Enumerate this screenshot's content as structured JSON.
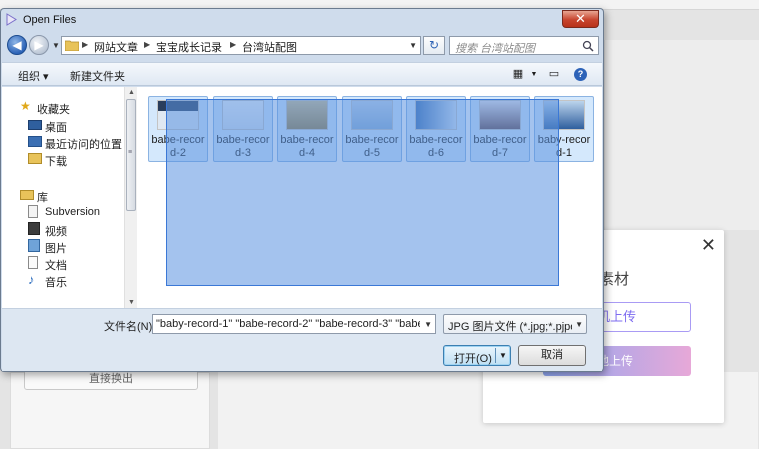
{
  "background": {
    "left_button_label": "直接换出",
    "modal": {
      "close_icon": "close-icon",
      "title_partial": "素材",
      "button_outline_label": "机上传",
      "button_gradient_label": "地上传",
      "colors": {
        "outline_accent": "#a99bf4",
        "gradient_start": "#8ea6f0",
        "gradient_end": "#e7a8d8"
      }
    }
  },
  "dialog": {
    "title": "Open Files",
    "close_label": "✕",
    "address": {
      "breadcrumbs": [
        "网站文章",
        "宝宝成长记录",
        "台湾站配图"
      ]
    },
    "search": {
      "placeholder": "搜索 台湾站配图"
    },
    "toolbar": {
      "organize_label": "组织 ▾",
      "new_folder_label": "新建文件夹"
    },
    "nav": {
      "favorites_header": "收藏夹",
      "favorites": [
        "桌面",
        "最近访问的位置",
        "下载"
      ],
      "libraries_header": "库",
      "libraries": [
        "Subversion",
        "视频",
        "图片",
        "文档",
        "音乐"
      ]
    },
    "files": [
      {
        "name": "babe-record-2",
        "icon": "image-thumbnail"
      },
      {
        "name": "babe-record-3",
        "icon": "image-thumbnail"
      },
      {
        "name": "babe-record-4",
        "icon": "image-thumbnail"
      },
      {
        "name": "babe-record-5",
        "icon": "image-thumbnail"
      },
      {
        "name": "babe-record-6",
        "icon": "image-thumbnail"
      },
      {
        "name": "babe-record-7",
        "icon": "image-thumbnail"
      },
      {
        "name": "baby-record-1",
        "icon": "image-thumbnail"
      }
    ],
    "filename": {
      "label": "文件名(N):",
      "value": "\"baby-record-1\" \"babe-record-2\" \"babe-record-3\" \"babe-re"
    },
    "filetype": {
      "value": "JPG 图片文件 (*.jpg;*.pjpeg;*."
    },
    "buttons": {
      "open_label": "打开(O)",
      "cancel_label": "取消"
    },
    "colors": {
      "selection_fill": "#5a92e0",
      "selection_border": "#3b78d6",
      "item_selected": "#cde4fc",
      "close_button": "#c7452e"
    }
  }
}
